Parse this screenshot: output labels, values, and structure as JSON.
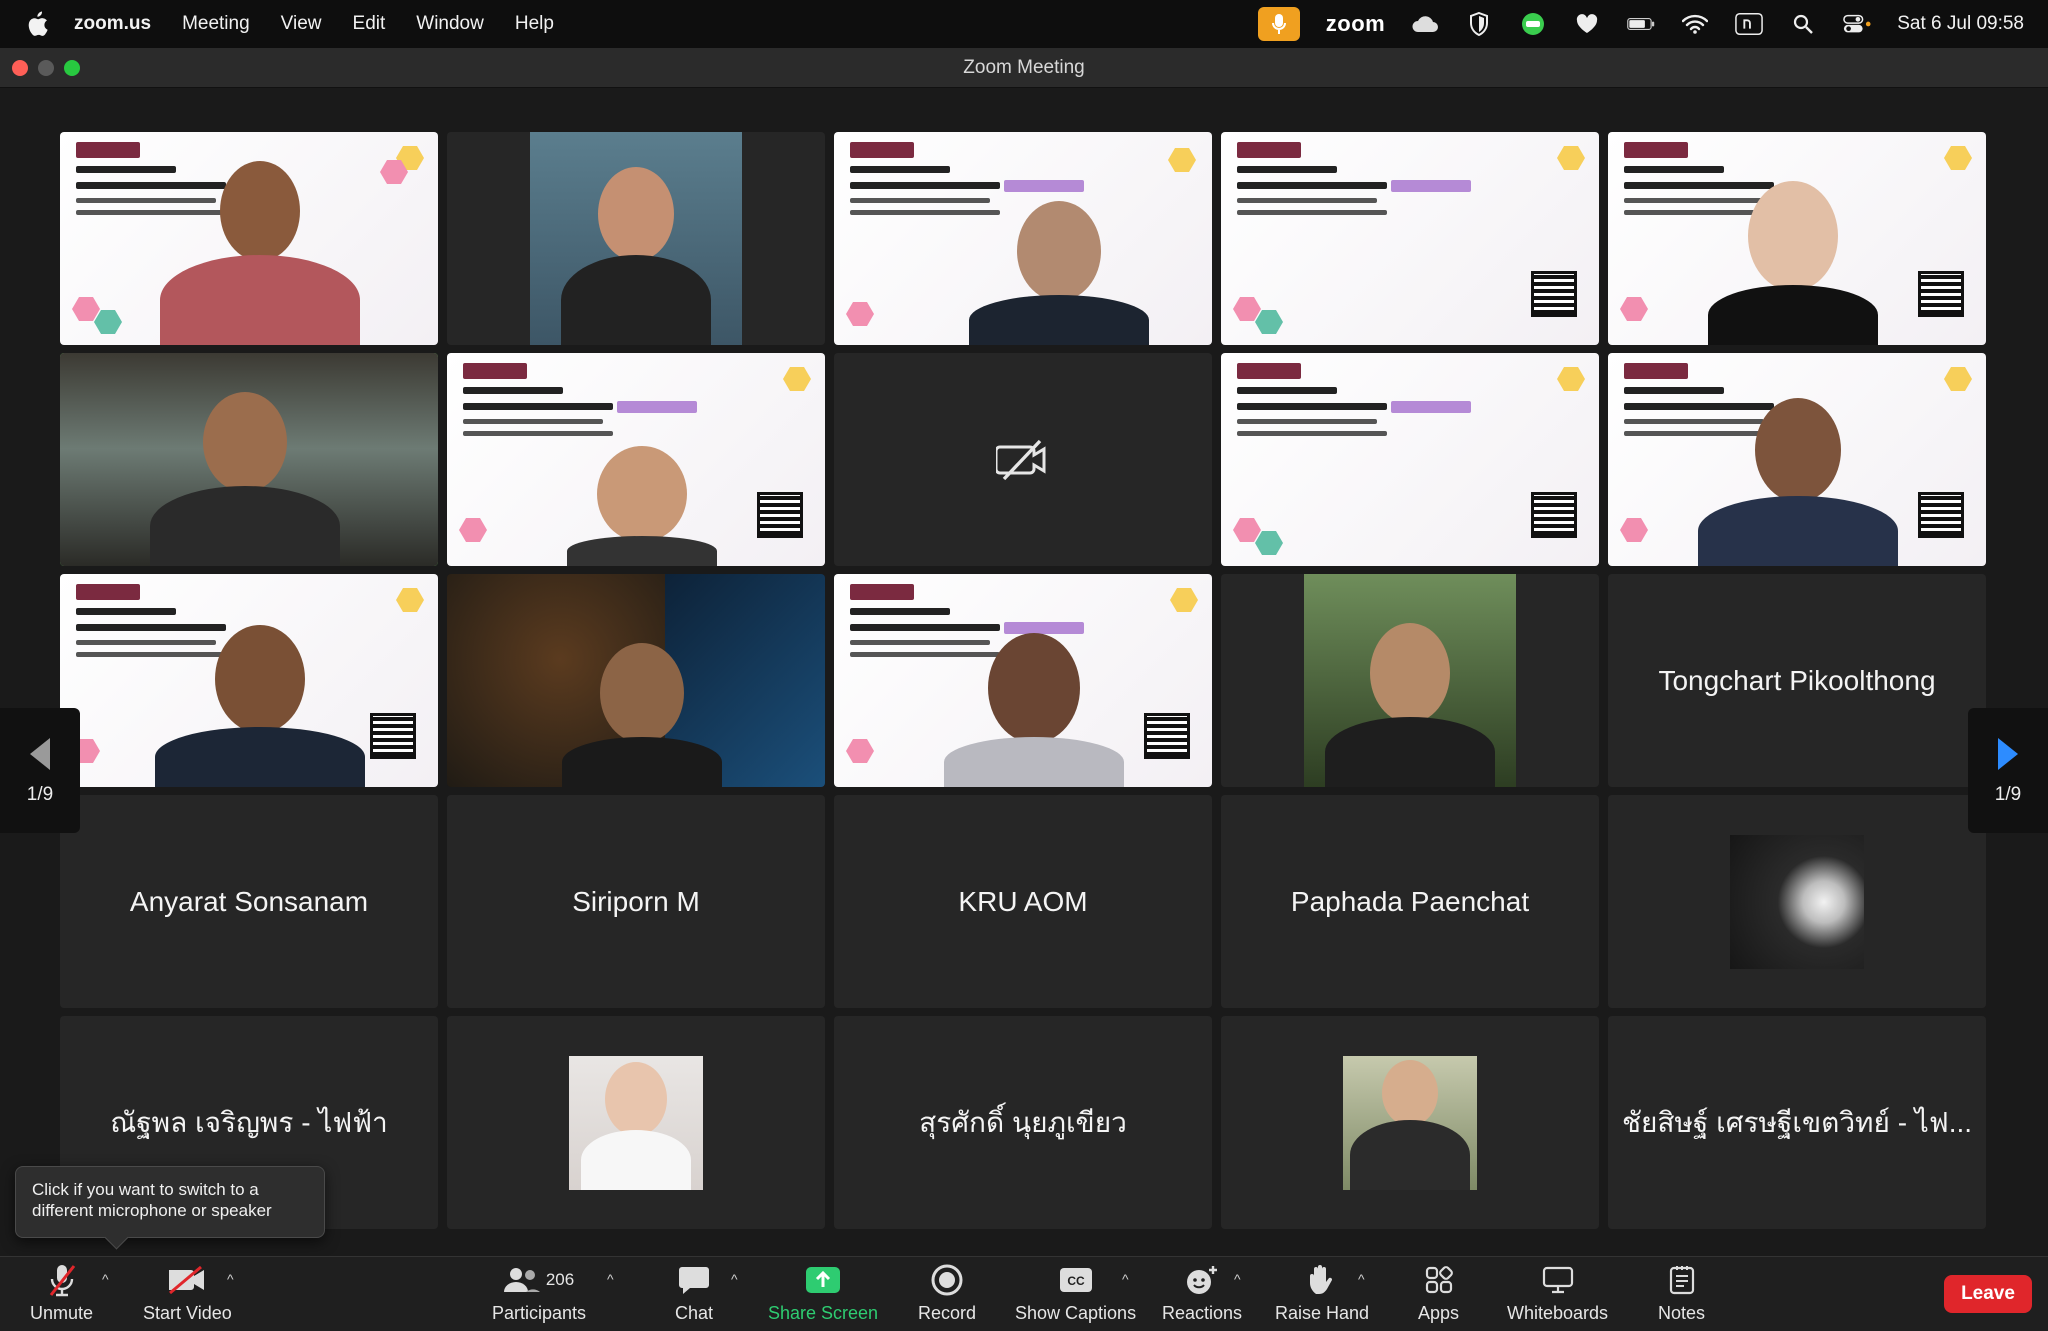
{
  "menubar": {
    "app": "zoom.us",
    "items": [
      "Meeting",
      "View",
      "Edit",
      "Window",
      "Help"
    ],
    "zoom_label": "zoom",
    "clock": "Sat 6 Jul  09:58"
  },
  "window": {
    "title": "Zoom Meeting"
  },
  "gallery": {
    "page_left": "1/9",
    "page_right": "1/9",
    "named_tiles": {
      "r3c5": "Tongchart Pikoolthong",
      "r4c1": "Anyarat Sonsanam",
      "r4c2": "Siriporn M",
      "r4c3": "KRU AOM",
      "r4c4": "Paphada Paenchat",
      "r5c1": "ณัฐพล เจริญพร - ไฟฟ้า",
      "r5c3": "สุรศักดิ์ นุยภูเขียว",
      "r5c5": "ชัยสิษฐ์ เศรษฐีเขตวิทย์ - ไฟ..."
    }
  },
  "tooltip": {
    "text": "Click if you want to switch to a different microphone or speaker"
  },
  "toolbar": {
    "unmute": "Unmute",
    "start_video": "Start Video",
    "participants": "Participants",
    "participants_count": "206",
    "chat": "Chat",
    "share_screen": "Share Screen",
    "record": "Record",
    "show_captions": "Show Captions",
    "reactions": "Reactions",
    "raise_hand": "Raise Hand",
    "apps": "Apps",
    "whiteboards": "Whiteboards",
    "notes": "Notes",
    "leave": "Leave"
  },
  "colors": {
    "active_speaker": "#6ddb63",
    "share_green": "#2ecc71",
    "leave_red": "#e0262b",
    "mic_pill": "#f0a020"
  }
}
